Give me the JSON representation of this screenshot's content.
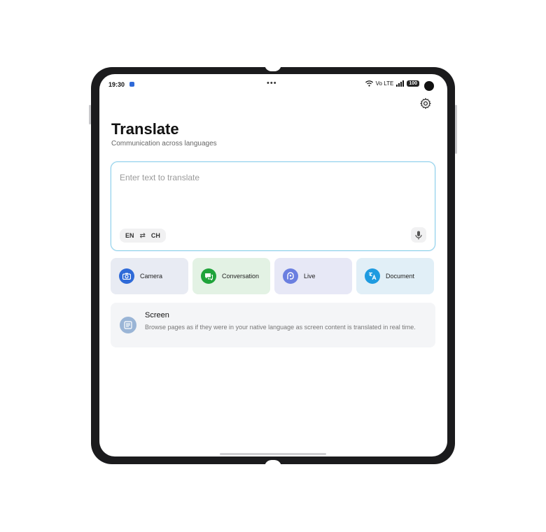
{
  "status_bar": {
    "time": "19:30",
    "signal_text": "Vo LTE",
    "battery": "100"
  },
  "header": {
    "title": "Translate",
    "subtitle": "Communication across languages"
  },
  "input": {
    "placeholder": "Enter text to translate",
    "source_lang": "EN",
    "swap_symbol": "⇄",
    "target_lang": "CH"
  },
  "features": [
    {
      "label": "Camera",
      "icon": "camera-icon",
      "bg": "#e8ebf3",
      "icon_color": "#2f6ad8"
    },
    {
      "label": "Conversation",
      "icon": "chat-icon",
      "bg": "#e3f2e4",
      "icon_color": "#1fa33a"
    },
    {
      "label": "Live",
      "icon": "live-icon",
      "bg": "#e7e8f6",
      "icon_color": "#6b7fe0"
    },
    {
      "label": "Document",
      "icon": "document-icon",
      "bg": "#e1eff7",
      "icon_color": "#1e9be0"
    }
  ],
  "screen_feature": {
    "title": "Screen",
    "description": "Browse pages as if they were in your native language as screen content is translated in real time.",
    "icon": "screen-icon"
  }
}
